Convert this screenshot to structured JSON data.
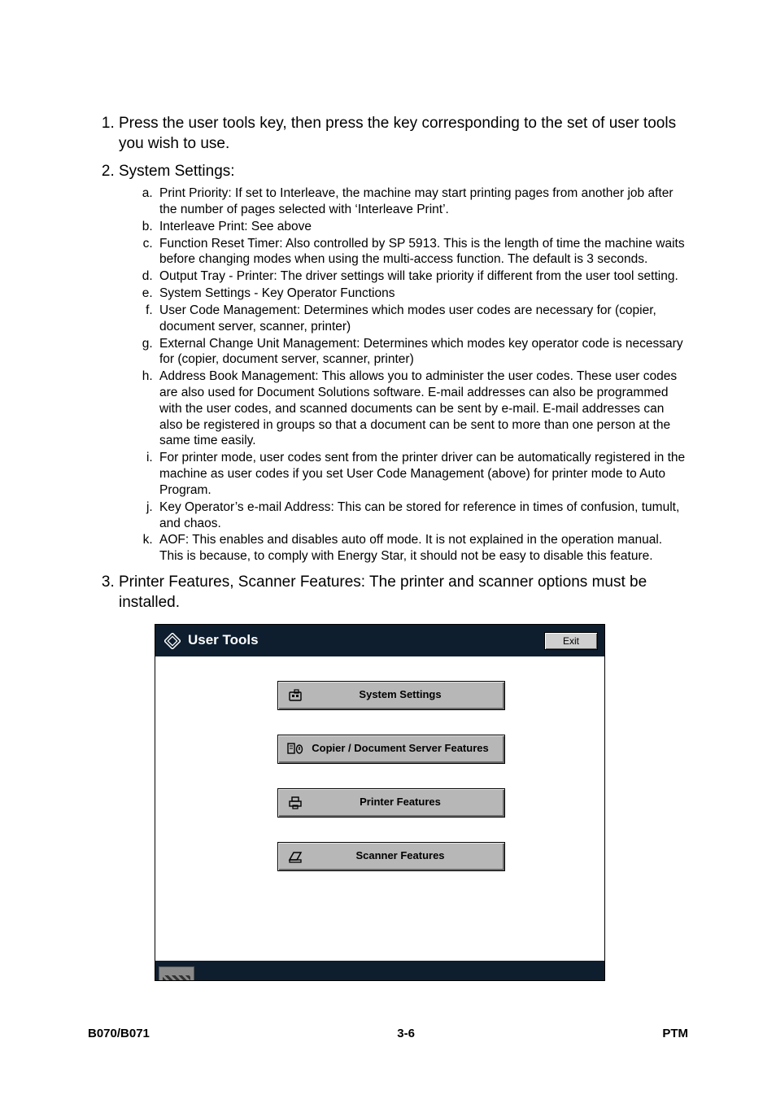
{
  "items": [
    {
      "head": "Press the user tools key, then press the key corresponding to the set of user tools you wish to use."
    },
    {
      "head": "System Settings:",
      "sub": [
        "Print Priority: If set to Interleave, the machine may start printing pages from another job after the number of pages selected with ‘Interleave Print’.",
        "Interleave Print: See above",
        "Function Reset Timer: Also controlled by SP 5913. This is the length of time the machine waits before changing modes when using the multi-access function. The default is 3 seconds.",
        "Output Tray - Printer: The driver settings will take priority if different from the user tool setting.",
        "System Settings - Key Operator Functions",
        "User Code Management: Determines which modes user codes are necessary for (copier, document server, scanner, printer)",
        "External Change Unit Management: Determines which modes key operator code is necessary for (copier, document server, scanner, printer)",
        "Address Book Management: This allows you to administer the user codes. These user codes are also used for Document Solutions software. E-mail addresses can also be programmed with the user codes, and scanned documents can be sent by e-mail. E-mail addresses can also be registered in groups so that a document can be sent to more than one person at the same time easily.",
        "For printer mode, user codes sent from the printer driver can be automatically registered in the machine as user codes if you set User Code Management (above) for printer mode to Auto Program.",
        "Key Operator’s e-mail Address: This can be stored for reference in times of confusion, tumult, and chaos.",
        "AOF: This enables and disables auto off mode. It is not explained in the operation manual. This is because, to comply with Energy Star, it should not be easy to disable this feature."
      ]
    },
    {
      "head": "Printer Features, Scanner Features: The printer and scanner options must be installed."
    }
  ],
  "panel": {
    "title": "User Tools",
    "exit": "Exit",
    "buttons": [
      "System Settings",
      "Copier / Document Server Features",
      "Printer Features",
      "Scanner Features"
    ]
  },
  "footer": {
    "left": "B070/B071",
    "center": "3-6",
    "right": "PTM"
  }
}
